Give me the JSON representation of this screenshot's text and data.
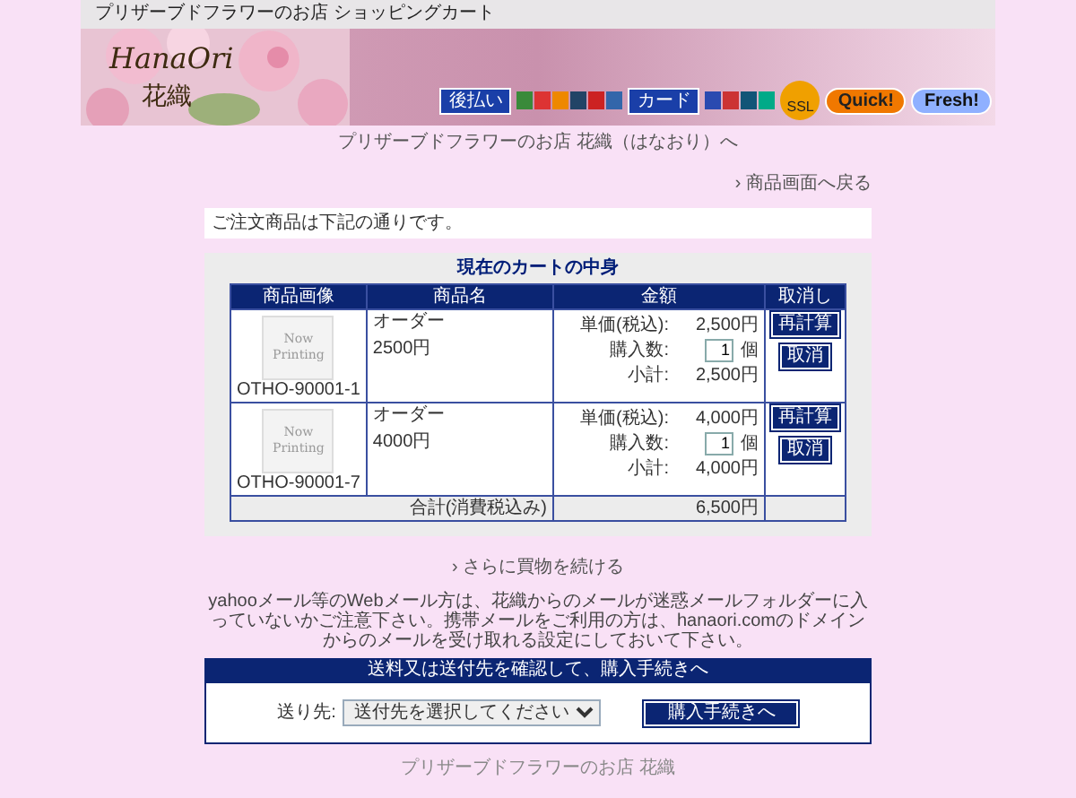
{
  "header": {
    "title": "プリザーブドフラワーのお店 ショッピングカート"
  },
  "banner": {
    "logo_script": "HanaOri",
    "logo_kanji": "花織",
    "badges": [
      {
        "text": "後払い",
        "kind": "pay"
      },
      {
        "text": "カード",
        "kind": "pay"
      },
      {
        "text": "SSL",
        "kind": "ssl"
      },
      {
        "text": "Quick!",
        "kind": "quick"
      },
      {
        "text": "Fresh!",
        "kind": "fresh"
      }
    ]
  },
  "home_link": "プリザーブドフラワーのお店 花織（はなおり）へ",
  "back_link": "› 商品画面へ戻る",
  "order_note": "ご注文商品は下記の通りです。",
  "cart": {
    "title": "現在のカートの中身",
    "columns": [
      "商品画像",
      "商品名",
      "金額",
      "取消し"
    ],
    "items": [
      {
        "image_text": "Now Printing",
        "code": "OTHO-90001-1",
        "name": "オーダー",
        "variant": "2500円",
        "unit_label": "単価(税込):",
        "unit_price": "2,500円",
        "qty_label": "購入数:",
        "qty": "1",
        "qty_unit": "個",
        "subtotal_label": "小計:",
        "subtotal": "2,500円",
        "recalc": "再計算",
        "remove": "取消"
      },
      {
        "image_text": "Now Printing",
        "code": "OTHO-90001-7",
        "name": "オーダー",
        "variant": "4000円",
        "unit_label": "単価(税込):",
        "unit_price": "4,000円",
        "qty_label": "購入数:",
        "qty": "1",
        "qty_unit": "個",
        "subtotal_label": "小計:",
        "subtotal": "4,000円",
        "recalc": "再計算",
        "remove": "取消"
      }
    ],
    "total_label": "合計(消費税込み)",
    "total": "6,500円"
  },
  "continue_link": "› さらに買物を続ける",
  "mail_notice": "yahooメール等のWebメール方は、花織からのメールが迷惑メールフォルダーに入っていないかご注意下さい。携帯メールをご利用の方は、hanaori.comのドメインからのメールを受け取れる設定にしておいて下さい。",
  "checkout": {
    "title": "送料又は送付先を確認して、購入手続きへ",
    "destination_label": "送り先:",
    "destination_value": "送付先を選択してください",
    "button": "購入手続きへ"
  },
  "footer": "プリザーブドフラワーのお店 花織"
}
